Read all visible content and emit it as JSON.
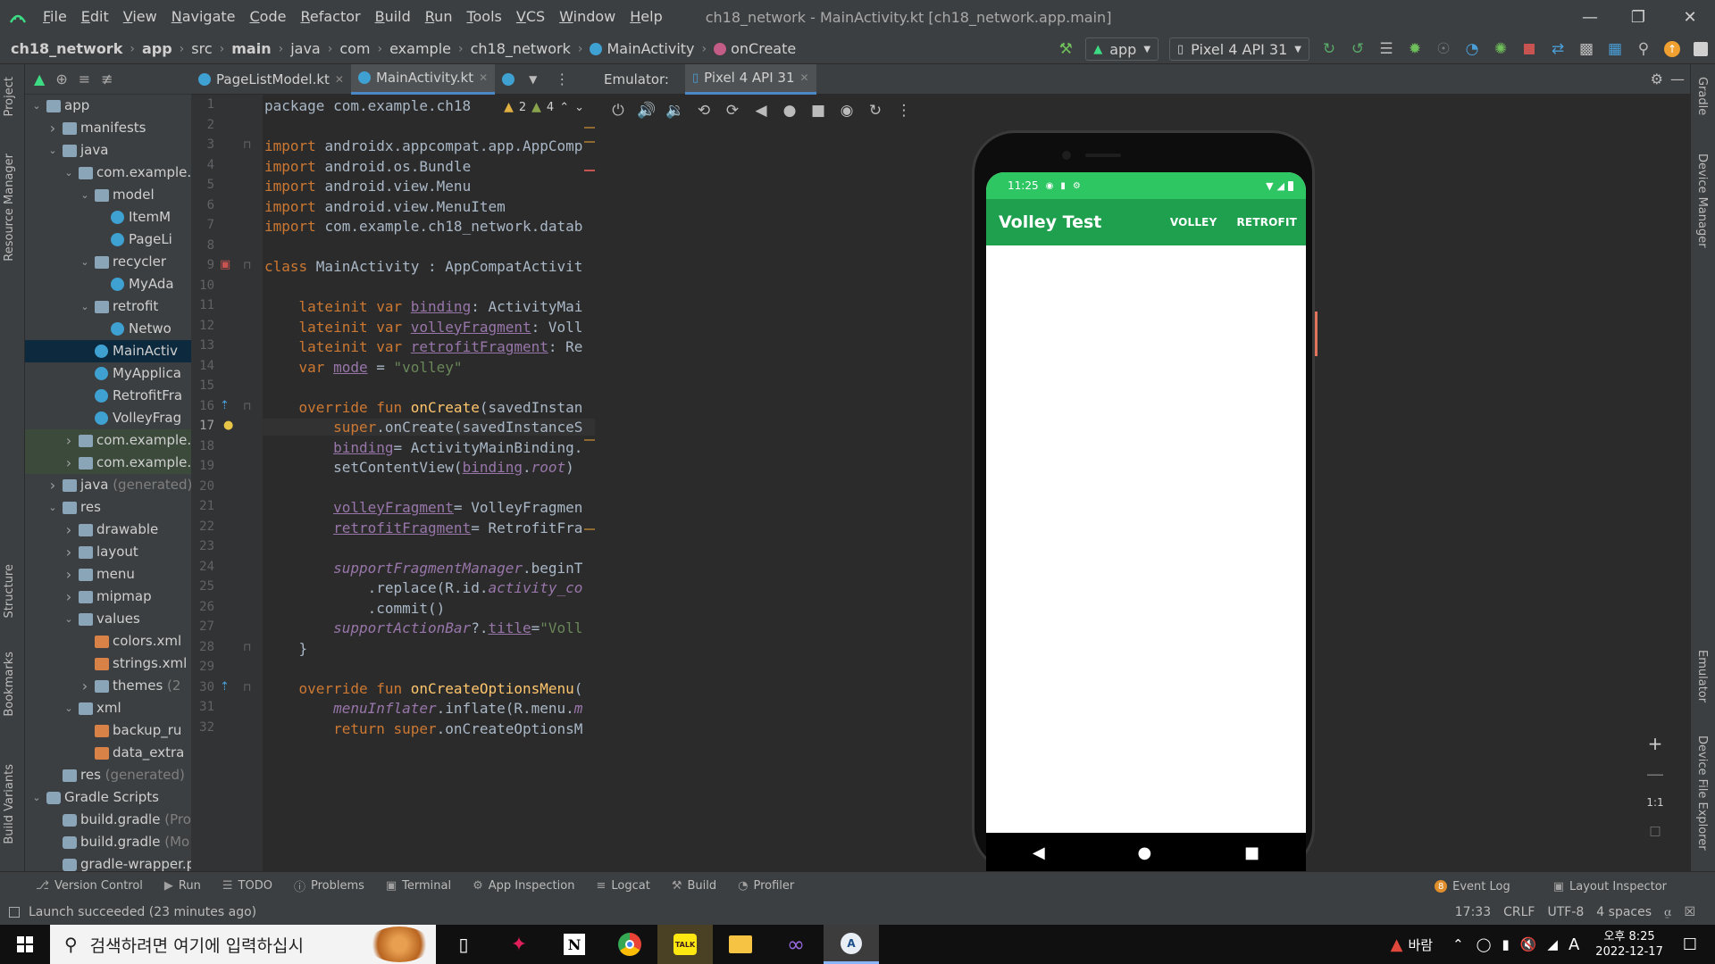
{
  "window": {
    "title": "ch18_network - MainActivity.kt [ch18_network.app.main]",
    "menu": [
      "File",
      "Edit",
      "View",
      "Navigate",
      "Code",
      "Refactor",
      "Build",
      "Run",
      "Tools",
      "VCS",
      "Window",
      "Help"
    ]
  },
  "breadcrumb": [
    "ch18_network",
    "app",
    "src",
    "main",
    "java",
    "com",
    "example",
    "ch18_network",
    "MainActivity",
    "onCreate"
  ],
  "toolbar": {
    "run_config": "app",
    "device": "Pixel 4 API 31"
  },
  "left_tool_tabs": [
    "Project",
    "Resource Manager",
    "Structure",
    "Bookmarks",
    "Build Variants"
  ],
  "right_tool_tabs": [
    "Gradle",
    "Device Manager",
    "Emulator",
    "Device File Explorer"
  ],
  "project_tree": [
    {
      "label": "app",
      "depth": 0,
      "arrow": "open",
      "icon": "folder"
    },
    {
      "label": "manifests",
      "depth": 1,
      "arrow": "closed",
      "icon": "folder"
    },
    {
      "label": "java",
      "depth": 1,
      "arrow": "open",
      "icon": "folder"
    },
    {
      "label": "com.example.",
      "depth": 2,
      "arrow": "open",
      "icon": "folder"
    },
    {
      "label": "model",
      "depth": 3,
      "arrow": "open",
      "icon": "folder"
    },
    {
      "label": "ItemM",
      "depth": 4,
      "arrow": "",
      "icon": "kt"
    },
    {
      "label": "PageLi",
      "depth": 4,
      "arrow": "",
      "icon": "kt"
    },
    {
      "label": "recycler",
      "depth": 3,
      "arrow": "open",
      "icon": "folder"
    },
    {
      "label": "MyAda",
      "depth": 4,
      "arrow": "",
      "icon": "kt"
    },
    {
      "label": "retrofit",
      "depth": 3,
      "arrow": "open",
      "icon": "folder"
    },
    {
      "label": "Netwo",
      "depth": 4,
      "arrow": "",
      "icon": "kt"
    },
    {
      "label": "MainActiv",
      "depth": 3,
      "arrow": "",
      "icon": "kt",
      "state": "selected"
    },
    {
      "label": "MyApplica",
      "depth": 3,
      "arrow": "",
      "icon": "kt"
    },
    {
      "label": "RetrofitFra",
      "depth": 3,
      "arrow": "",
      "icon": "kt"
    },
    {
      "label": "VolleyFrag",
      "depth": 3,
      "arrow": "",
      "icon": "kt"
    },
    {
      "label": "com.example.",
      "depth": 2,
      "arrow": "closed",
      "icon": "folder",
      "state": "green"
    },
    {
      "label": "com.example.",
      "depth": 2,
      "arrow": "closed",
      "icon": "folder",
      "state": "green"
    },
    {
      "label": "java",
      "suffix": " (generated)",
      "depth": 1,
      "arrow": "closed",
      "icon": "folder"
    },
    {
      "label": "res",
      "depth": 1,
      "arrow": "open",
      "icon": "res"
    },
    {
      "label": "drawable",
      "depth": 2,
      "arrow": "closed",
      "icon": "folder"
    },
    {
      "label": "layout",
      "depth": 2,
      "arrow": "closed",
      "icon": "folder"
    },
    {
      "label": "menu",
      "depth": 2,
      "arrow": "closed",
      "icon": "folder"
    },
    {
      "label": "mipmap",
      "depth": 2,
      "arrow": "closed",
      "icon": "folder"
    },
    {
      "label": "values",
      "depth": 2,
      "arrow": "open",
      "icon": "folder"
    },
    {
      "label": "colors.xml",
      "depth": 3,
      "arrow": "",
      "icon": "xml"
    },
    {
      "label": "strings.xml",
      "depth": 3,
      "arrow": "",
      "icon": "xml"
    },
    {
      "label": "themes",
      "suffix": " (2",
      "depth": 3,
      "arrow": "closed",
      "icon": "folder"
    },
    {
      "label": "xml",
      "depth": 2,
      "arrow": "open",
      "icon": "folder"
    },
    {
      "label": "backup_ru",
      "depth": 3,
      "arrow": "",
      "icon": "xml"
    },
    {
      "label": "data_extra",
      "depth": 3,
      "arrow": "",
      "icon": "xml"
    },
    {
      "label": "res",
      "suffix": " (generated)",
      "depth": 1,
      "arrow": "",
      "icon": "res"
    },
    {
      "label": "Gradle Scripts",
      "depth": 0,
      "arrow": "open",
      "icon": "gradle"
    },
    {
      "label": "build.gradle",
      "suffix": " (Pro",
      "depth": 1,
      "arrow": "",
      "icon": "gradle"
    },
    {
      "label": "build.gradle",
      "suffix": " (Mo",
      "depth": 1,
      "arrow": "",
      "icon": "gradle"
    },
    {
      "label": "gradle-wrapper.p",
      "depth": 1,
      "arrow": "",
      "icon": "gradle"
    }
  ],
  "editor": {
    "tabs": [
      {
        "label": "PageListModel.kt",
        "active": false
      },
      {
        "label": "MainActivity.kt",
        "active": true
      }
    ],
    "inspection": {
      "warnings": "2",
      "weak_warnings": "4"
    },
    "current_line": 17,
    "lines": [
      [
        {
          "t": "package com.example.ch18",
          "c": ""
        }
      ],
      [],
      [
        {
          "t": "import ",
          "c": "kw"
        },
        {
          "t": "androidx.appcompat.app.AppComp",
          "c": ""
        }
      ],
      [
        {
          "t": "import ",
          "c": "kw"
        },
        {
          "t": "android.os.Bundle",
          "c": ""
        }
      ],
      [
        {
          "t": "import ",
          "c": "kw"
        },
        {
          "t": "android.view.Menu",
          "c": ""
        }
      ],
      [
        {
          "t": "import ",
          "c": "kw"
        },
        {
          "t": "android.view.MenuItem",
          "c": ""
        }
      ],
      [
        {
          "t": "import ",
          "c": "kw"
        },
        {
          "t": "com.example.ch18_network.datab",
          "c": ""
        }
      ],
      [],
      [
        {
          "t": "class ",
          "c": "kw"
        },
        {
          "t": "MainActivity : AppCompatActivit",
          "c": ""
        }
      ],
      [],
      [
        {
          "t": "    lateinit var ",
          "c": "kw"
        },
        {
          "t": "binding",
          "c": "prop"
        },
        {
          "t": ": ActivityMai",
          "c": ""
        }
      ],
      [
        {
          "t": "    lateinit var ",
          "c": "kw"
        },
        {
          "t": "volleyFragment",
          "c": "prop"
        },
        {
          "t": ": Voll",
          "c": ""
        }
      ],
      [
        {
          "t": "    lateinit var ",
          "c": "kw"
        },
        {
          "t": "retrofitFragment",
          "c": "prop"
        },
        {
          "t": ": Re",
          "c": ""
        }
      ],
      [
        {
          "t": "    var ",
          "c": "kw"
        },
        {
          "t": "mode",
          "c": "prop"
        },
        {
          "t": " = ",
          "c": ""
        },
        {
          "t": "\"volley\"",
          "c": "str"
        }
      ],
      [],
      [
        {
          "t": "    override fun ",
          "c": "kw"
        },
        {
          "t": "onCreate",
          "c": "fn"
        },
        {
          "t": "(savedInstan",
          "c": ""
        }
      ],
      [
        {
          "t": "        super",
          "c": "kw"
        },
        {
          "t": ".onCreate(savedInstanceS",
          "c": ""
        }
      ],
      [
        {
          "t": "        ",
          "c": ""
        },
        {
          "t": "binding",
          "c": "prop"
        },
        {
          "t": "= ActivityMainBinding.",
          "c": ""
        }
      ],
      [
        {
          "t": "        setContentView(",
          "c": ""
        },
        {
          "t": "binding",
          "c": "prop"
        },
        {
          "t": ".",
          "c": ""
        },
        {
          "t": "root",
          "c": "ital"
        },
        {
          "t": ")",
          "c": ""
        }
      ],
      [],
      [
        {
          "t": "        ",
          "c": ""
        },
        {
          "t": "volleyFragment",
          "c": "prop"
        },
        {
          "t": "= VolleyFragmen",
          "c": ""
        }
      ],
      [
        {
          "t": "        ",
          "c": ""
        },
        {
          "t": "retrofitFragment",
          "c": "prop"
        },
        {
          "t": "= RetrofitFra",
          "c": ""
        }
      ],
      [],
      [
        {
          "t": "        ",
          "c": ""
        },
        {
          "t": "supportFragmentManager",
          "c": "ital"
        },
        {
          "t": ".beginT",
          "c": ""
        }
      ],
      [
        {
          "t": "            .replace(R.id.",
          "c": ""
        },
        {
          "t": "activity_co",
          "c": "ital"
        }
      ],
      [
        {
          "t": "            .commit()",
          "c": ""
        }
      ],
      [
        {
          "t": "        ",
          "c": ""
        },
        {
          "t": "supportActionBar",
          "c": "ital"
        },
        {
          "t": "?.",
          "c": ""
        },
        {
          "t": "title",
          "c": "prop"
        },
        {
          "t": "=",
          "c": ""
        },
        {
          "t": "\"Voll",
          "c": "str"
        }
      ],
      [
        {
          "t": "    }",
          "c": ""
        }
      ],
      [],
      [
        {
          "t": "    override fun ",
          "c": "kw"
        },
        {
          "t": "onCreateOptionsMenu",
          "c": "fn"
        },
        {
          "t": "(",
          "c": ""
        }
      ],
      [
        {
          "t": "        ",
          "c": ""
        },
        {
          "t": "menuInflater",
          "c": "ital"
        },
        {
          "t": ".inflate(R.menu.",
          "c": ""
        },
        {
          "t": "m",
          "c": "ital"
        }
      ],
      [
        {
          "t": "        return super",
          "c": "kw"
        },
        {
          "t": ".onCreateOptionsM",
          "c": ""
        }
      ]
    ]
  },
  "emulator": {
    "label": "Emulator:",
    "tab": "Pixel 4 API 31",
    "zoom_ratio": "1:1",
    "phone": {
      "time": "11:25",
      "app_title": "Volley Test",
      "actions": [
        "VOLLEY",
        "RETROFIT"
      ],
      "status_color": "#2ec662",
      "appbar_color": "#1fa04e"
    }
  },
  "bottom_tools": [
    "Version Control",
    "Run",
    "TODO",
    "Problems",
    "Terminal",
    "App Inspection",
    "Logcat",
    "Build",
    "Profiler"
  ],
  "bottom_right": {
    "event_log": "Event Log",
    "event_count": "8",
    "layout_inspector": "Layout Inspector"
  },
  "status": {
    "message": "Launch succeeded (23 minutes ago)",
    "position": "17:33",
    "line_sep": "CRLF",
    "encoding": "UTF-8",
    "indent": "4 spaces"
  },
  "taskbar": {
    "search_placeholder": "검색하려면 여기에 입력하십시",
    "weather": "바람",
    "ime": "A",
    "time": "오후 8:25",
    "date": "2022-12-17"
  }
}
